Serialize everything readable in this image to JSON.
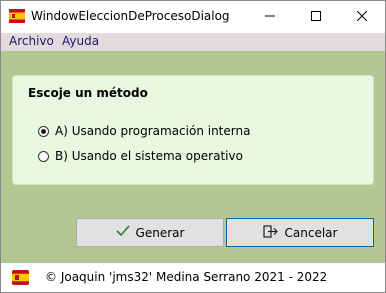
{
  "window": {
    "title": "WindowEleccionDeProcesoDialog"
  },
  "menu": {
    "items": [
      {
        "label": "Archivo"
      },
      {
        "label": "Ayuda"
      }
    ]
  },
  "group": {
    "title": "Escoje un método",
    "options": [
      {
        "label": "A) Usando programación interna",
        "checked": true
      },
      {
        "label": "B) Usando el sistema operativo",
        "checked": false
      }
    ]
  },
  "buttons": {
    "generar": "Generar",
    "cancelar": "Cancelar"
  },
  "status": {
    "text": "© Joaquin 'jms32' Medina Serrano 2021 - 2022"
  },
  "colors": {
    "content_bg": "#b3c793",
    "group_bg": "#e8f8e0",
    "menubar_bg": "#e4d9dc",
    "menu_text": "#1a1a6e",
    "accent_border": "#0b6aa6"
  },
  "icons": {
    "app": "spain-flag-icon",
    "generar": "checkmark-icon",
    "cancelar": "exit-door-icon",
    "status": "spain-flag-icon"
  }
}
